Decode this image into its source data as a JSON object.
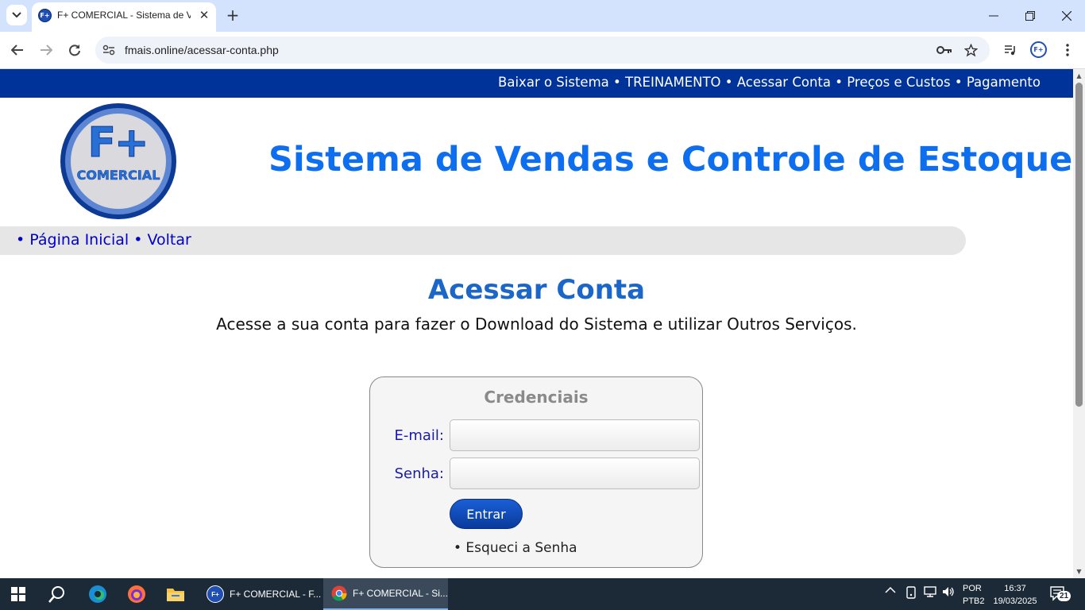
{
  "browser": {
    "tab_title": "F+ COMERCIAL - Sistema de Vendas",
    "favicon_text": "F+",
    "url": "fmais.online/acessar-conta.php",
    "new_tab": "+",
    "close": "✕"
  },
  "topnav": {
    "items": [
      "Baixar o Sistema",
      "TREINAMENTO",
      "Acessar Conta",
      "Preços e Custos",
      "Pagamento"
    ],
    "separator": "•"
  },
  "logo": {
    "mark": "F+",
    "word": "COMERCIAL"
  },
  "header": {
    "title": "Sistema de Vendas e Controle de Estoque"
  },
  "subnav": {
    "items": [
      "Página Inicial",
      "Voltar"
    ],
    "bullet": "•"
  },
  "main": {
    "title": "Acessar Conta",
    "subtitle": "Acesse a sua conta para fazer o Download do Sistema e utilizar Outros Serviços."
  },
  "login": {
    "title": "Credenciais",
    "email_label": "E-mail:",
    "email_value": "",
    "password_label": "Senha:",
    "password_value": "",
    "submit_label": "Entrar",
    "forgot_label": "• Esqueci a Senha"
  },
  "taskbar": {
    "apps": [
      {
        "label": "F+ COMERCIAL - F...",
        "icon": "fplus-icon"
      },
      {
        "label": "F+ COMERCIAL - Si...",
        "icon": "chrome-icon",
        "active": true
      }
    ],
    "lang_top": "POR",
    "lang_bottom": "PTB2",
    "time": "16:37",
    "date": "19/03/2025",
    "notifications": "21"
  },
  "colors": {
    "topnav_bg": "#003399",
    "headline": "#0d6ef0",
    "link": "#0000cc",
    "button": "#0a3a9c"
  }
}
